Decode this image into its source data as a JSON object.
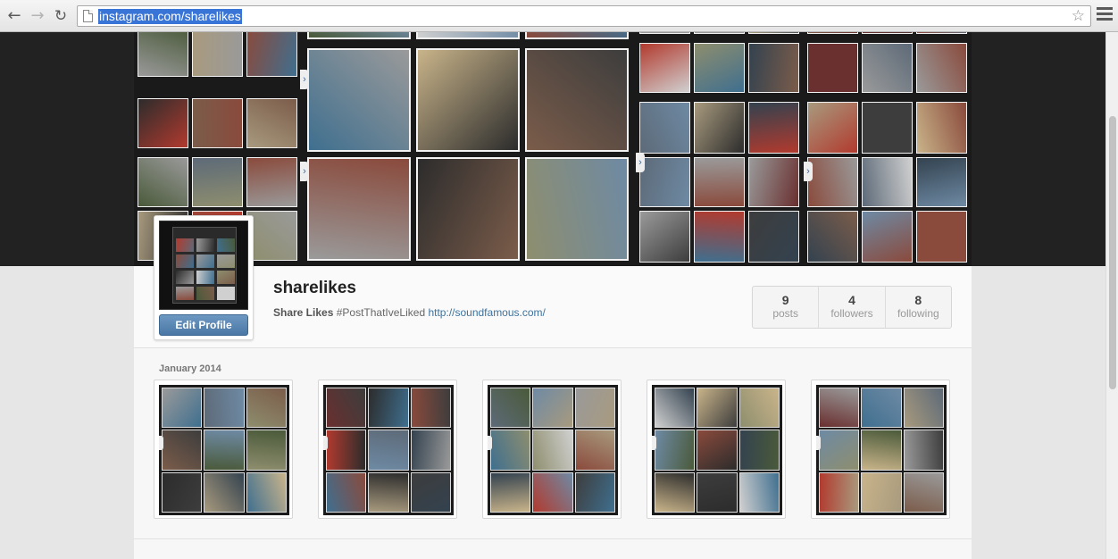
{
  "browser": {
    "url": "instagram.com/sharelikes",
    "back_icon": "arrow-left",
    "forward_icon": "arrow-right",
    "reload_icon": "reload",
    "bookmark_icon": "star",
    "menu_icon": "hamburger"
  },
  "profile": {
    "username": "sharelikes",
    "display_name": "Share Likes",
    "bio": "#PostThatIveLiked",
    "website": "http://soundfamous.com/",
    "edit_button": "Edit Profile"
  },
  "stats": [
    {
      "value": "9",
      "label": "posts"
    },
    {
      "value": "4",
      "label": "followers"
    },
    {
      "value": "8",
      "label": "following"
    }
  ],
  "feed": {
    "month_label": "January 2014",
    "post_count_shown": 5
  },
  "colors": {
    "link": "#3f729b",
    "button": "#4a77a5",
    "selection": "#3875d7"
  }
}
